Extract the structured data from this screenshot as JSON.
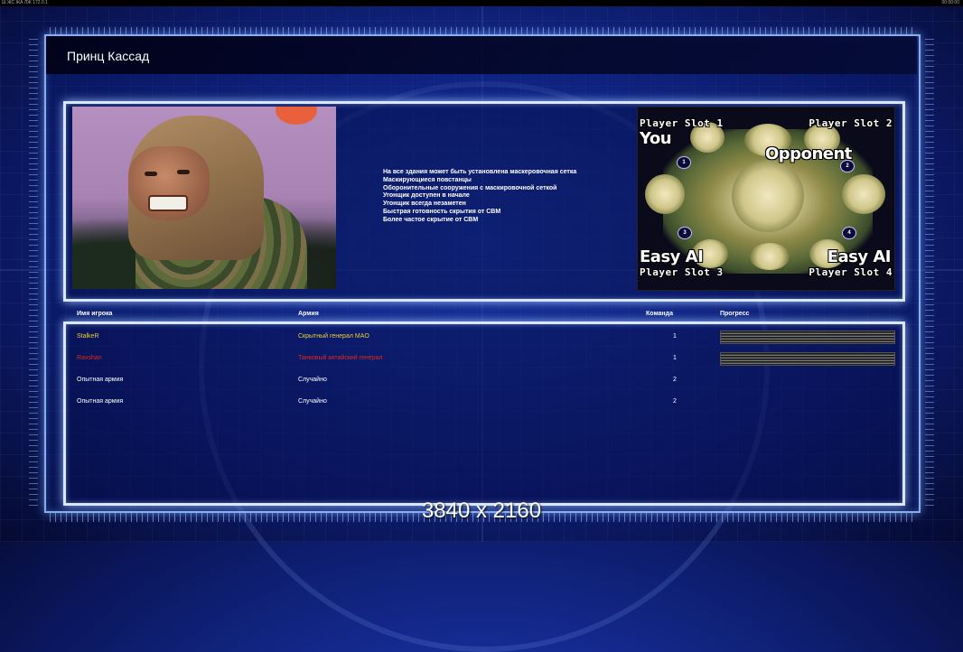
{
  "window": {
    "topbar_left": "Ш  ЖС  ЖА  ЛЖ  172.0.1",
    "topbar_right": "00:00:00"
  },
  "title": "Принц Кассад",
  "general": {
    "description": [
      "На все здания может быть установлена маскеровочная сетка",
      "Маскирующиеся повстанцы",
      "Оборонительные сооружения с маскировочной сеткой",
      "Угонщик доступен в начале",
      "Угонщик всегда незаметен",
      "Быстрая готовность скрытия от СВМ",
      "Более частое скрытие от СВМ"
    ]
  },
  "minimap": {
    "slot1_label": "Player Slot 1",
    "slot2_label": "Player Slot 2",
    "slot3_label": "Player Slot 3",
    "slot4_label": "Player Slot 4",
    "slot1_player": "You",
    "slot2_player": "Opponent",
    "slot3_player": "Easy AI",
    "slot4_player": "Easy AI",
    "markers": [
      "1",
      "2",
      "3",
      "4"
    ]
  },
  "table": {
    "headers": {
      "name": "Имя игрока",
      "army": "Армия",
      "team": "Команда",
      "progress": "Прогресс"
    },
    "rows": [
      {
        "name": "StalkeR",
        "army": "Скрытный генерал MAO",
        "team": "1",
        "color": "#e8d23a",
        "progress": true
      },
      {
        "name": "Ravshan",
        "army": "Танковый китайский генерал",
        "team": "1",
        "color": "#e0281e",
        "progress": true
      },
      {
        "name": "Опытная армия",
        "army": "Случайно",
        "team": "2",
        "color": "#ffffff",
        "progress": false
      },
      {
        "name": "Опытная армия",
        "army": "Случайно",
        "team": "2",
        "color": "#ffffff",
        "progress": false
      }
    ]
  },
  "overlay": {
    "resolution": "3840 x 2160"
  }
}
